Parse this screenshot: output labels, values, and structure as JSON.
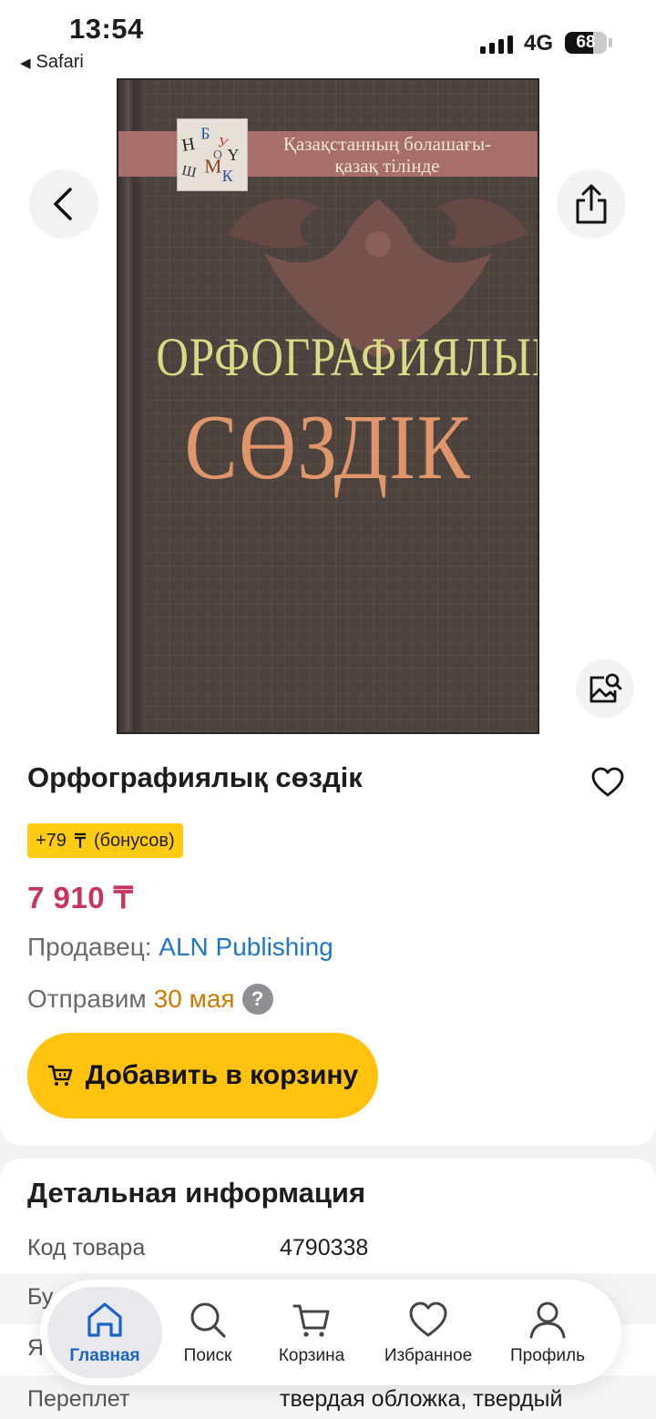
{
  "status_bar": {
    "time": "13:54",
    "back_app": "Safari",
    "network": "4G",
    "battery": "68",
    "battery_level": 0.68
  },
  "cover": {
    "series_line1": "Қазақстанның болашағы-",
    "series_line2": "қазақ тілінде",
    "title_line1": "ОРФОГРАФИЯЛЫҚ",
    "title_line2": "СӨЗДІК"
  },
  "product": {
    "title": "Орфографиялық сөздік",
    "bonus_amount": "+79",
    "bonus_label": "(бонусов)",
    "price": "7 910 ₸",
    "seller_label": "Продавец:",
    "seller_name": "ALN Publishing",
    "ship_label": "Отправим",
    "ship_date": "30 мая",
    "help_glyph": "?",
    "add_to_cart": "Добавить в корзину"
  },
  "details": {
    "heading": "Детальная информация",
    "rows": [
      {
        "key": "Код товара",
        "value": "4790338"
      },
      {
        "key": "Бу",
        "value": ""
      },
      {
        "key": "Я",
        "value": ""
      },
      {
        "key": "Переплет",
        "value": "твердая обложка, твердый"
      }
    ]
  },
  "tabbar": {
    "tabs": [
      {
        "label": "Главная",
        "icon": "home-icon",
        "active": true
      },
      {
        "label": "Поиск",
        "icon": "search-icon"
      },
      {
        "label": "Корзина",
        "icon": "cart-icon"
      },
      {
        "label": "Избранное",
        "icon": "heart-icon"
      },
      {
        "label": "Профиль",
        "icon": "profile-icon"
      }
    ]
  },
  "colors": {
    "accent_yellow": "#fec20f",
    "price_red": "#c8345b",
    "link_blue": "#1f76c7",
    "ship_orange": "#cc7a00",
    "tab_active_blue": "#1a64c8"
  }
}
